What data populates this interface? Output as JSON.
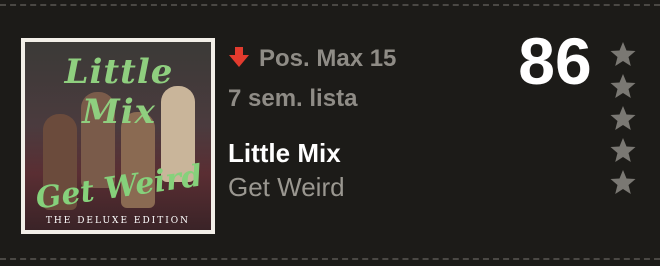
{
  "album_cover": {
    "title_art": "Little Mix",
    "subtitle_art": "Get Weird",
    "edition_art": "THE DELUXE EDITION"
  },
  "chart_entry": {
    "trend_icon": "down-arrow-icon",
    "trend_color": "#e23b2e",
    "peak_position": "Pos. Max 15",
    "weeks_on_chart": "7 sem. lista",
    "artist": "Little Mix",
    "album": "Get Weird",
    "rank": "86"
  },
  "rating": {
    "max_stars": 5,
    "filled_stars": 0,
    "star_icon": "star-icon",
    "star_color": "#7a7873"
  }
}
